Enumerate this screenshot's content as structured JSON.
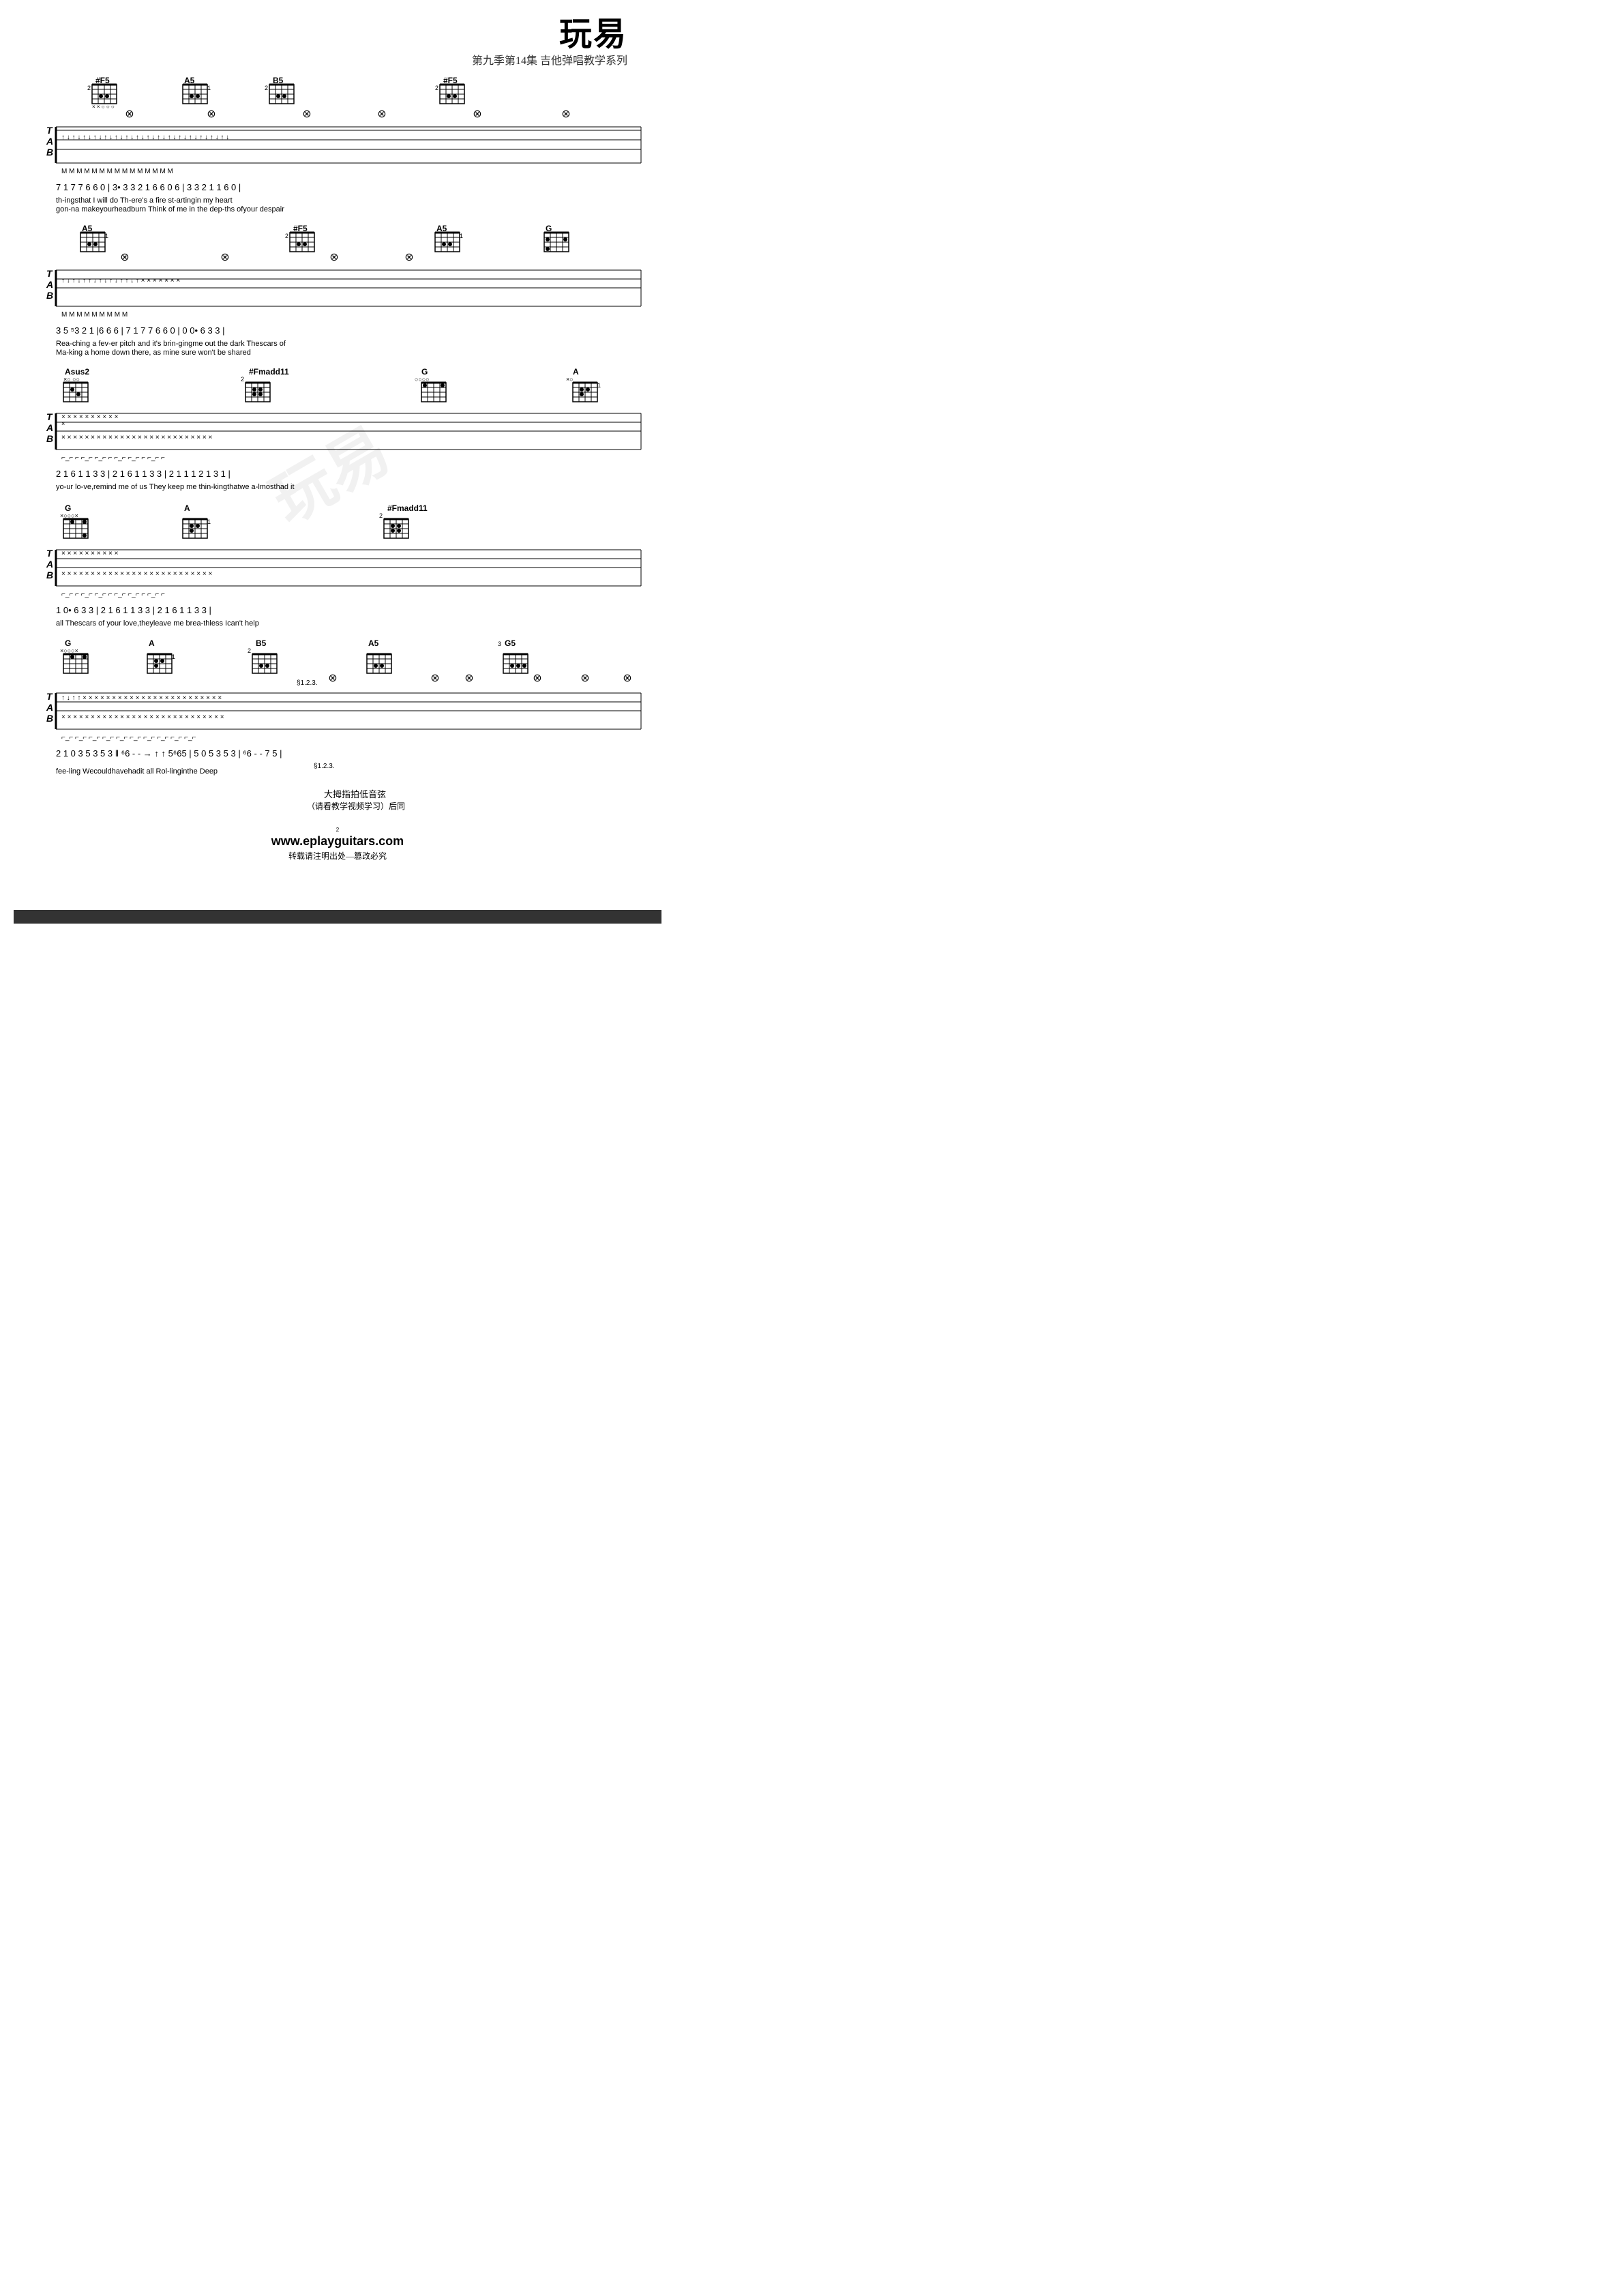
{
  "header": {
    "brand": "玩易",
    "subtitle": "第九季第14集  吉他弹唱教学系列"
  },
  "sections": [
    {
      "id": "section1",
      "chords": [
        "#F5",
        "A5",
        "B5",
        "#F5"
      ],
      "tab_lines": {
        "T": "arrows and dots",
        "A": "arrows and dots",
        "B": "7 1 7  7 6 6 0 | 3• 3 3  2 1 6 6 0 6 | 3 3  2 1 1  6  0 |"
      },
      "lyrics": [
        "th-ingsthat I will do    Th-ere's    a fire    st-artingin my  heart",
        "gon-na makeyourheadburn    Think of    me in    the dep-ths ofyour despair"
      ]
    },
    {
      "id": "section2",
      "chords": [
        "A5",
        "#F5",
        "A5",
        "G"
      ],
      "tab_lines": {
        "B": "3  5  ⁵3 2 1  |6  6  6  | 7  1 7   7  6  6  0   | 0   0• 6   3   3  |"
      },
      "lyrics": [
        "Rea-ching  a fev-er pitch  and  it's brin-gingme out the dark         Thescars of",
        "Ma-king  a    home down there, as  mine sure  won't be shared"
      ]
    },
    {
      "id": "section3",
      "chords": [
        "Asus2",
        "#Fmadd11",
        "G",
        "A"
      ],
      "tab_lines": {
        "B": "2 1 6  1 1   3   3   | 2 1 6  1 1  3  3  |  2   1   1 1  2  1   3 1  |"
      },
      "lyrics": [
        "yo-ur   lo-ve,remind  me     of usThey  keep   me    thin-kingthatwe  a-lmosthad it"
      ]
    },
    {
      "id": "section4",
      "chords": [
        "G",
        "A",
        "#Fmadd11"
      ],
      "tab_lines": {
        "B": "1    0•  6   3    3   | 2 1 6   1  1   3  3   |  2  1  6   1 1   3   3   |"
      },
      "lyrics": [
        "all        Thescars of    your   love,theyleave  me    brea-thless  Ican't help"
      ]
    },
    {
      "id": "section5",
      "chords": [
        "G",
        "A",
        "B5",
        "A5",
        "G5"
      ],
      "tab_lines": {
        "B": "2  1 0 3  5  3  5 3 ‖ ⁶6 - - - → ↑  5⁶65  |  5  0   5  3  5 3  | ⁶6  -  -   7 5  |"
      },
      "lyrics": [
        "fee-ling   Wecouldhavehadit  all               Rol-linginthe Deep"
      ]
    }
  ],
  "thumb_note": {
    "line1": "大拇指拍低音弦",
    "line2": "（请看教学视频学习）后同",
    "marker": "§1.2.3."
  },
  "footer": {
    "url": "www.eplayguitars.com",
    "page_number": "2",
    "copyright": "转载请注明出处—篡改必究"
  }
}
